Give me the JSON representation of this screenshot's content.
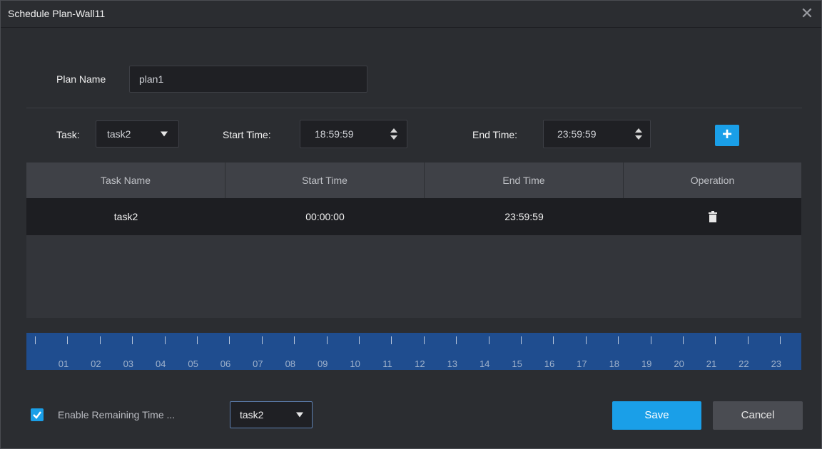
{
  "window": {
    "title": "Schedule Plan-Wall11",
    "close_icon": "close-icon"
  },
  "plan": {
    "label": "Plan Name",
    "value": "plan1"
  },
  "filters": {
    "task_label": "Task:",
    "task_value": "task2",
    "start_label": "Start Time:",
    "start_value": "18:59:59",
    "end_label": "End Time:",
    "end_value": "23:59:59",
    "add_icon": "plus-icon"
  },
  "table": {
    "columns": [
      "Task Name",
      "Start Time",
      "End Time",
      "Operation"
    ],
    "rows": [
      {
        "task_name": "task2",
        "start_time": "00:00:00",
        "end_time": "23:59:59",
        "operation_icon": "trash-icon"
      }
    ]
  },
  "timeline": {
    "hours": [
      "01",
      "02",
      "03",
      "04",
      "05",
      "06",
      "07",
      "08",
      "09",
      "10",
      "11",
      "12",
      "13",
      "14",
      "15",
      "16",
      "17",
      "18",
      "19",
      "20",
      "21",
      "22",
      "23"
    ],
    "color": "#1f4d8f"
  },
  "footer": {
    "checkbox_checked": true,
    "remaining_label": "Enable Remaining Time ...",
    "remaining_task": "task2",
    "save_label": "Save",
    "cancel_label": "Cancel"
  },
  "colors": {
    "accent": "#1a9fe8",
    "background": "#2b2d31"
  }
}
